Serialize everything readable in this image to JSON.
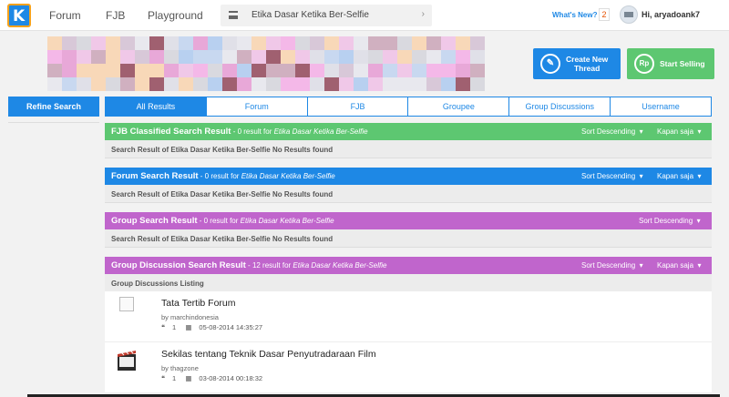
{
  "nav": {
    "logo": "K",
    "links": [
      "Forum",
      "FJB",
      "Playground"
    ],
    "search_value": "Etika Dasar Ketika Ber-Selfie",
    "whats_new": "What's New?",
    "notif_count": "2",
    "greeting": "Hi, aryadoank7"
  },
  "actions": {
    "create_thread": [
      "Create New",
      "Thread"
    ],
    "start_selling": "Start Selling",
    "rp_icon": "Rp"
  },
  "sidebar": {
    "refine_label": "Refine Search"
  },
  "tabs": [
    "All Results",
    "Forum",
    "FJB",
    "Groupee",
    "Group Discussions",
    "Username"
  ],
  "sections": {
    "fjb": {
      "title": "FJB Classified Search Result",
      "result": " - 0 result for ",
      "query": "Etika Dasar Ketika Ber-Selfie",
      "sort": "Sort Descending",
      "time": "Kapan saja",
      "body": "Search Result of Etika Dasar Ketika Ber-Selfie No Results found"
    },
    "forum": {
      "title": "Forum Search Result",
      "result": " - 0 result for ",
      "query": "Etika Dasar Ketika Ber-Selfie",
      "sort": "Sort Descending",
      "time": "Kapan saja",
      "body": "Search Result of Etika Dasar Ketika Ber-Selfie No Results found"
    },
    "group": {
      "title": "Group Search Result",
      "result": " - 0 result for ",
      "query": "Etika Dasar Ketika Ber-Selfie",
      "sort": "Sort Descending",
      "body": "Search Result of Etika Dasar Ketika Ber-Selfie No Results found"
    },
    "discussion": {
      "title": "Group Discussion Search Result",
      "result": " - 12 result for ",
      "query": "Etika Dasar Ketika Ber-Selfie",
      "sort": "Sort Descending",
      "time": "Kapan saja",
      "listing": "Group Discussions Listing",
      "items": [
        {
          "title": "Tata Tertib Forum",
          "by": "by marchindonesia",
          "replies": "1",
          "date": "05-08-2014 14:35:27"
        },
        {
          "title": "Sekilas tentang Teknik Dasar Penyutradaraan Film",
          "by": "by thagzone",
          "replies": "1",
          "date": "03-08-2014 00:18:32"
        }
      ]
    }
  },
  "colors": {
    "green": "#5dc771",
    "blue": "#1e88e5",
    "purple": "#c065cc",
    "orange": "#f7a21b"
  }
}
